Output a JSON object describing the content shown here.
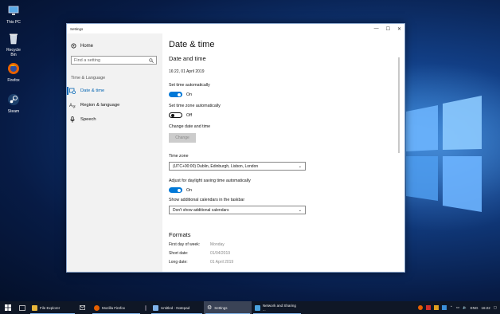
{
  "desktop": {
    "icons": [
      {
        "label": "This PC",
        "icon": "computer-icon"
      },
      {
        "label": "Recycle Bin",
        "icon": "recycle-bin-icon"
      },
      {
        "label": "Firefox",
        "icon": "firefox-icon"
      },
      {
        "label": "Steam",
        "icon": "steam-icon"
      }
    ]
  },
  "window": {
    "title": "Settings",
    "controls": {
      "minimize": "—",
      "maximize": "☐",
      "close": "✕"
    }
  },
  "sidebar": {
    "home_label": "Home",
    "search_placeholder": "Find a setting",
    "section_title": "Time & Language",
    "items": [
      {
        "label": "Date & time",
        "icon": "calendar-clock-icon",
        "active": true
      },
      {
        "label": "Region & language",
        "icon": "globe-language-icon",
        "active": false
      },
      {
        "label": "Speech",
        "icon": "microphone-icon",
        "active": false
      }
    ]
  },
  "main": {
    "page_title": "Date & time",
    "section_title": "Date and time",
    "current_datetime": "16:22, 01 April 2019",
    "set_time_auto": {
      "label": "Set time automatically",
      "state": "On"
    },
    "set_timezone_auto": {
      "label": "Set time zone automatically",
      "state": "Off"
    },
    "change_datetime": {
      "label": "Change date and time",
      "button": "Change"
    },
    "time_zone": {
      "label": "Time zone",
      "value": "(UTC+00:00) Dublin, Edinburgh, Lisbon, London"
    },
    "dst": {
      "label": "Adjust for daylight saving time automatically",
      "state": "On"
    },
    "calendars": {
      "label": "Show additional calendars in the taskbar",
      "value": "Don't show additional calendars"
    },
    "formats": {
      "title": "Formats",
      "rows": [
        {
          "key": "First day of week:",
          "value": "Monday"
        },
        {
          "key": "Short date:",
          "value": "01/04/2019"
        },
        {
          "key": "Long date:",
          "value": "01 April 2019"
        }
      ]
    }
  },
  "taskbar": {
    "items": [
      {
        "label": "File Explorer",
        "icon": "folder-icon",
        "color": "#e8b63a"
      },
      {
        "label": "Mozilla Firefox",
        "icon": "firefox-icon",
        "color": "#e66000"
      },
      {
        "label": "Untitled - Notepad",
        "icon": "notepad-icon",
        "color": "#7fb3ea"
      },
      {
        "label": "Settings",
        "icon": "gear-icon",
        "color": "#cccccc"
      },
      {
        "label": "Network and Sharing ...",
        "icon": "network-icon",
        "color": "#4aa3df"
      }
    ],
    "language": "ENG",
    "clock": "16:22"
  },
  "colors": {
    "accent": "#0078d7",
    "active_nav": "#0063b1"
  }
}
